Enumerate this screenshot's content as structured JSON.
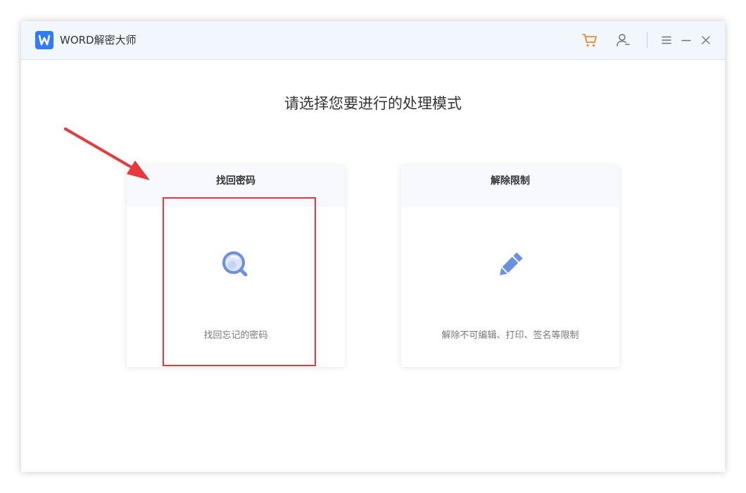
{
  "app": {
    "title": "WORD解密大师",
    "logo_letter": "W",
    "logo_color": "#2f7cf6"
  },
  "titlebar": {
    "icons": [
      "cart-icon",
      "user-icon",
      "menu-icon",
      "minimize-icon",
      "close-icon"
    ],
    "cart_color": "#f08a24"
  },
  "main": {
    "title": "请选择您要进行的处理模式"
  },
  "cards": [
    {
      "title": "找回密码",
      "description": "找回忘记的密码",
      "icon": "magnifier-icon"
    },
    {
      "title": "解除限制",
      "description": "解除不可编辑、打印、签名等限制",
      "icon": "pencil-icon"
    }
  ],
  "annotation": {
    "color": "#e8383b"
  }
}
